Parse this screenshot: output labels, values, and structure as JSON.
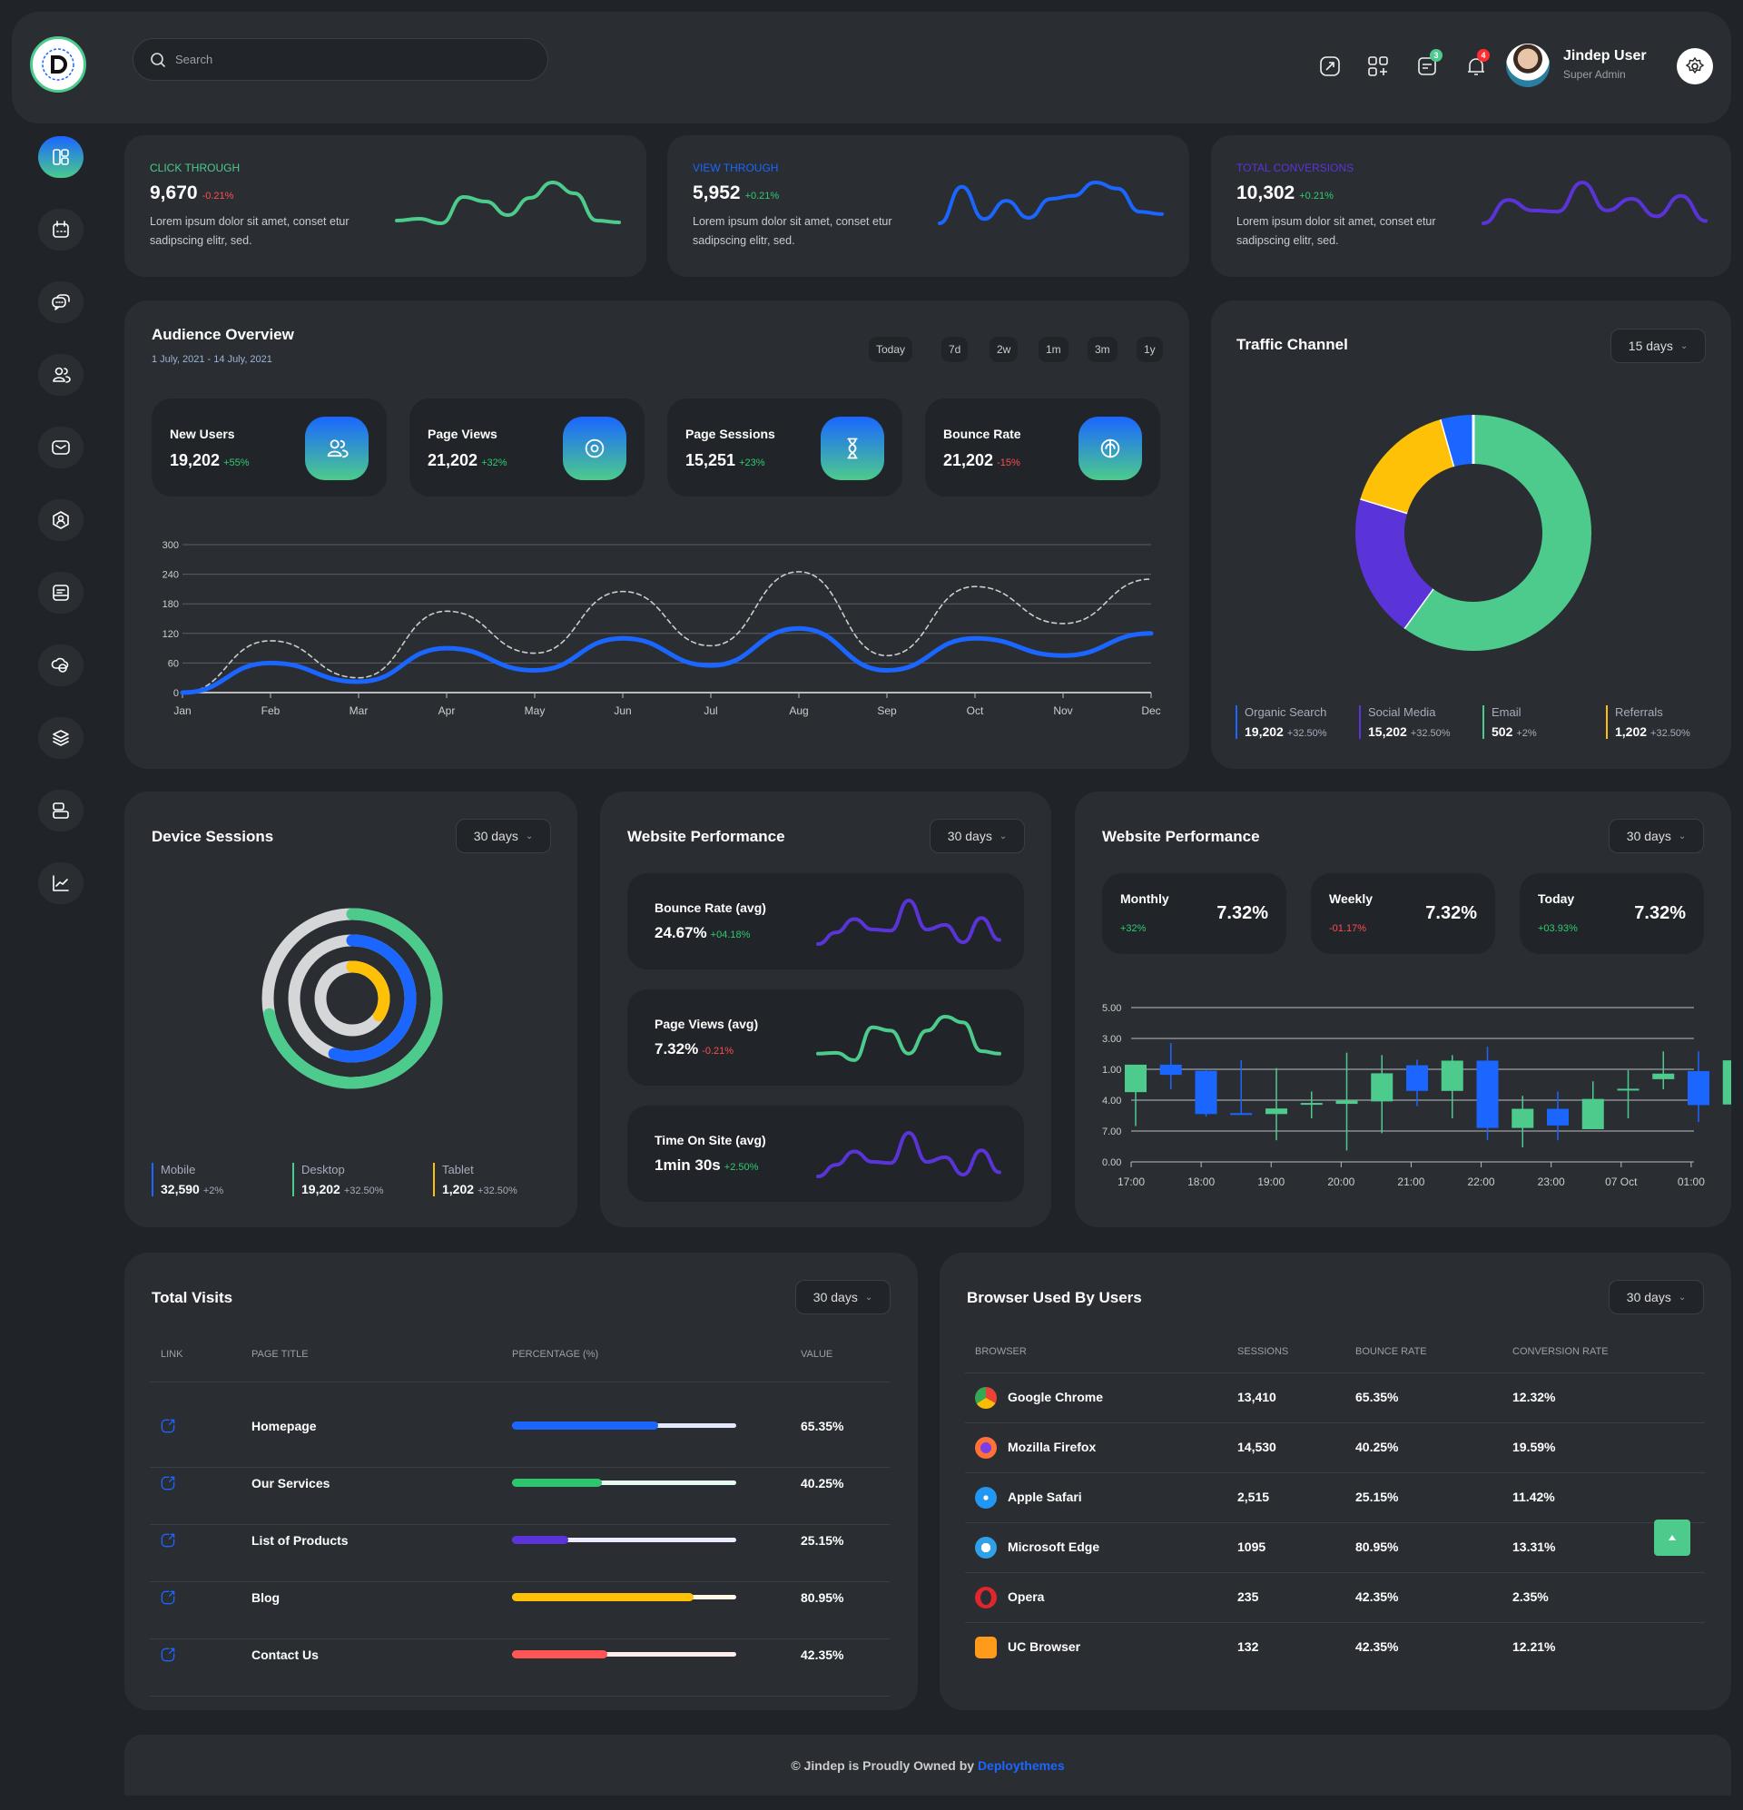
{
  "header": {
    "search_placeholder": "Search",
    "user_name": "Jindep User",
    "user_role": "Super Admin",
    "messages_badge": "3",
    "notifications_badge": "4",
    "logo_text": "DEPLOY THEMES"
  },
  "sidebar": {
    "items": [
      {
        "icon": "dashboard-icon",
        "active": true
      },
      {
        "icon": "calendar-icon"
      },
      {
        "icon": "chat-icon"
      },
      {
        "icon": "users-icon"
      },
      {
        "icon": "mail-icon"
      },
      {
        "icon": "profile-icon"
      },
      {
        "icon": "notes-icon"
      },
      {
        "icon": "cloud-icon"
      },
      {
        "icon": "layers-icon"
      },
      {
        "icon": "server-icon"
      },
      {
        "icon": "analytics-icon"
      }
    ]
  },
  "top_cards": [
    {
      "label": "CLICK THROUGH",
      "value": "9,670",
      "change": "-0.21%",
      "trend": "down",
      "desc1": "Lorem ipsum dolor sit amet, conset etur",
      "desc2": "sadipscing elitr, sed.",
      "color": "#4ccb8c",
      "spark": [
        30,
        32,
        27,
        56,
        51,
        36,
        55,
        72,
        60,
        30,
        28
      ]
    },
    {
      "label": "VIEW THROUGH",
      "value": "5,952",
      "change": "+0.21%",
      "trend": "up",
      "desc1": "Lorem ipsum dolor sit amet, conset etur",
      "desc2": "sadipscing elitr, sed.",
      "color": "#1a66ff",
      "spark": [
        5,
        65,
        12,
        42,
        14,
        45,
        50,
        72,
        62,
        24,
        20
      ]
    },
    {
      "label": "TOTAL CONVERSIONS",
      "value": "10,302",
      "change": "+0.21%",
      "trend": "up",
      "desc1": "Lorem ipsum dolor sit amet, conset etur",
      "desc2": "sadipscing elitr, sed.",
      "color": "#5b34d9",
      "spark": [
        8,
        48,
        30,
        28,
        78,
        30,
        50,
        20,
        55,
        12
      ]
    }
  ],
  "audience": {
    "title": "Audience Overview",
    "date_range": "1 July, 2021 - 14 July, 2021",
    "ranges": [
      "Today",
      "7d",
      "2w",
      "1m",
      "3m",
      "1y"
    ],
    "stats": [
      {
        "label": "New Users",
        "value": "19,202",
        "change": "+55%",
        "trend": "up",
        "icon": "users-icon"
      },
      {
        "label": "Page Views",
        "value": "21,202",
        "change": "+32%",
        "trend": "up",
        "icon": "eye-icon"
      },
      {
        "label": "Page Sessions",
        "value": "15,251",
        "change": "+23%",
        "trend": "up",
        "icon": "hourglass-icon"
      },
      {
        "label": "Bounce Rate",
        "value": "21,202",
        "change": "-15%",
        "trend": "down",
        "icon": "bounce-icon"
      }
    ]
  },
  "traffic": {
    "title": "Traffic Channel",
    "range": "15 days",
    "legend": [
      {
        "name": "Organic Search",
        "value": "19,202",
        "change": "+32.50%",
        "color": "#1a66ff"
      },
      {
        "name": "Social Media",
        "value": "15,202",
        "change": "+32.50%",
        "color": "#5b34d9"
      },
      {
        "name": "Email",
        "value": "502",
        "change": "+2%",
        "color": "#4ccb8c"
      },
      {
        "name": "Referrals",
        "value": "1,202",
        "change": "+32.50%",
        "color": "#ffc107"
      }
    ]
  },
  "device": {
    "title": "Device Sessions",
    "range": "30 days",
    "legend": [
      {
        "name": "Mobile",
        "value": "32,590",
        "change": "+2%",
        "color": "#1a66ff"
      },
      {
        "name": "Desktop",
        "value": "19,202",
        "change": "+32.50%",
        "color": "#4ccb8c"
      },
      {
        "name": "Tablet",
        "value": "1,202",
        "change": "+32.50%",
        "color": "#ffc107"
      }
    ]
  },
  "perf": {
    "title": "Website Performance",
    "range": "30 days",
    "items": [
      {
        "label": "Bounce Rate (avg)",
        "value": "24.67%",
        "change": "+04.18%",
        "trend": "up",
        "color": "#5b34d9",
        "spark": [
          5,
          25,
          48,
          30,
          28,
          80,
          30,
          38,
          8,
          50,
          12
        ]
      },
      {
        "label": "Page Views (avg)",
        "value": "7.32%",
        "change": "-0.21%",
        "trend": "down",
        "color": "#4ccb8c",
        "spark": [
          30,
          31,
          22,
          62,
          58,
          30,
          58,
          75,
          68,
          33,
          30
        ]
      },
      {
        "label": "Time On Site (avg)",
        "value": "1min 30s",
        "change": "+2.50%",
        "trend": "up",
        "color": "#5b34d9",
        "spark": [
          5,
          25,
          48,
          30,
          28,
          80,
          30,
          38,
          8,
          50,
          12
        ]
      }
    ]
  },
  "perf2": {
    "title": "Website Performance",
    "range": "30 days",
    "cards": [
      {
        "label": "Monthly",
        "change": "+32%",
        "trend": "up",
        "value": "7.32%"
      },
      {
        "label": "Weekly",
        "change": "-01.17%",
        "trend": "down",
        "value": "7.32%"
      },
      {
        "label": "Today",
        "change": "+03.93%",
        "trend": "up",
        "value": "7.32%"
      }
    ]
  },
  "total_visits": {
    "title": "Total Visits",
    "range": "30 days",
    "columns": [
      "LINK",
      "PAGE TITLE",
      "PERCENTAGE (%)",
      "VALUE"
    ],
    "rows": [
      {
        "title": "Homepage",
        "percent": 65.35,
        "value": "65.35%",
        "color": "#1a66ff",
        "track": "#e3e8ff"
      },
      {
        "title": "Our Services",
        "percent": 40.25,
        "value": "40.25%",
        "color": "#2dc56e",
        "track": "#e6fbf0"
      },
      {
        "title": "List of Products",
        "percent": 25.15,
        "value": "25.15%",
        "color": "#5b34d9",
        "track": "#eeeaff"
      },
      {
        "title": "Blog",
        "percent": 80.95,
        "value": "80.95%",
        "color": "#ffc107",
        "track": "#fff8e6"
      },
      {
        "title": "Contact Us",
        "percent": 42.35,
        "value": "42.35%",
        "color": "#ff5555",
        "track": "#ffeded"
      }
    ]
  },
  "browsers": {
    "title": "Browser Used By Users",
    "range": "30 days",
    "columns": [
      "BROWSER",
      "SESSIONS",
      "BOUNCE RATE",
      "CONVERSION RATE"
    ],
    "rows": [
      {
        "name": "Google Chrome",
        "icon": "chrome-icon",
        "sessions": "13,410",
        "bounce": "65.35%",
        "conversion": "12.32%"
      },
      {
        "name": "Mozilla Firefox",
        "icon": "firefox-icon",
        "sessions": "14,530",
        "bounce": "40.25%",
        "conversion": "19.59%"
      },
      {
        "name": "Apple Safari",
        "icon": "safari-icon",
        "sessions": "2,515",
        "bounce": "25.15%",
        "conversion": "11.42%"
      },
      {
        "name": "Microsoft Edge",
        "icon": "edge-icon",
        "sessions": "1095",
        "bounce": "80.95%",
        "conversion": "13.31%"
      },
      {
        "name": "Opera",
        "icon": "opera-icon",
        "sessions": "235",
        "bounce": "42.35%",
        "conversion": "2.35%"
      },
      {
        "name": "UC Browser",
        "icon": "uc-browser-icon",
        "sessions": "132",
        "bounce": "42.35%",
        "conversion": "12.21%"
      }
    ]
  },
  "footer": {
    "text": "© Jindep is Proudly Owned by ",
    "link": "Deploythemes"
  },
  "colors": {
    "green": "#4ccb8c",
    "blue": "#1a66ff",
    "purple": "#5b34d9",
    "yellow": "#ffc107",
    "red": "#ff4d4d"
  },
  "chart_data": [
    {
      "type": "line",
      "categories": [
        "Jan",
        "Feb",
        "Mar",
        "Apr",
        "May",
        "Jun",
        "Jul",
        "Aug",
        "Sep",
        "Oct",
        "Nov",
        "Dec"
      ],
      "yticks": [
        "0",
        "60",
        "120",
        "180",
        "240",
        "300"
      ],
      "ylim": [
        0,
        300
      ],
      "grid": true,
      "series": [
        {
          "style": "solid",
          "color": "#1a66ff",
          "values": [
            0,
            60,
            22,
            90,
            45,
            110,
            55,
            130,
            45,
            110,
            75,
            120
          ]
        },
        {
          "style": "dashed",
          "color": "#cccccc",
          "values": [
            0,
            105,
            30,
            165,
            80,
            205,
            95,
            245,
            75,
            215,
            140,
            230
          ]
        }
      ]
    },
    {
      "type": "pie",
      "variant": "donut",
      "slices": [
        {
          "color": "#4ccb8c",
          "fraction": 0.6
        },
        {
          "color": "#5b34d9",
          "fraction": 0.197
        },
        {
          "color": "#ffc107",
          "fraction": 0.159
        },
        {
          "color": "#1a66ff",
          "fraction": 0.044
        }
      ]
    },
    {
      "type": "radial-bar",
      "rings": [
        {
          "color": "#4ccb8c",
          "fraction": 0.72
        },
        {
          "color": "#1a66ff",
          "fraction": 0.55
        },
        {
          "color": "#ffc107",
          "fraction": 0.34
        }
      ]
    },
    {
      "type": "candlestick",
      "ytick_labels": [
        "5.00",
        "3.00",
        "1.00",
        "4.00",
        "7.00",
        "0.00"
      ],
      "ylim": [
        0,
        5
      ],
      "xtick_labels": [
        "17:00",
        "18:00",
        "19:00",
        "20:00",
        "21:00",
        "22:00",
        "23:00",
        "07 Oct",
        "01:00"
      ],
      "candles": [
        {
          "t": "17:00",
          "o": 2.26,
          "h": 3.15,
          "l": 1.16,
          "c": 3.15
        },
        {
          "t": "17:30",
          "o": 3.15,
          "h": 3.85,
          "l": 2.35,
          "c": 2.82
        },
        {
          "t": "18:00",
          "o": 2.95,
          "h": 2.99,
          "l": 1.47,
          "c": 1.55
        },
        {
          "t": "18:30",
          "o": 1.58,
          "h": 3.29,
          "l": 1.56,
          "c": 1.56
        },
        {
          "t": "19:00",
          "o": 1.55,
          "h": 3.04,
          "l": 0.7,
          "c": 1.73
        },
        {
          "t": "19:30",
          "o": 1.85,
          "h": 2.28,
          "l": 1.41,
          "c": 1.91
        },
        {
          "t": "20:00",
          "o": 1.88,
          "h": 3.54,
          "l": 0.37,
          "c": 1.99
        },
        {
          "t": "20:30",
          "o": 1.96,
          "h": 3.46,
          "l": 0.93,
          "c": 2.87
        },
        {
          "t": "21:00",
          "o": 3.13,
          "h": 3.31,
          "l": 1.81,
          "c": 2.3
        },
        {
          "t": "21:30",
          "o": 2.3,
          "h": 3.46,
          "l": 1.41,
          "c": 3.28
        },
        {
          "t": "22:00",
          "o": 3.28,
          "h": 3.73,
          "l": 0.7,
          "c": 1.1
        },
        {
          "t": "22:30",
          "o": 1.1,
          "h": 2.14,
          "l": 0.47,
          "c": 1.72
        },
        {
          "t": "23:00",
          "o": 1.72,
          "h": 2.28,
          "l": 0.7,
          "c": 1.18
        },
        {
          "t": "23:30",
          "o": 1.06,
          "h": 2.61,
          "l": 1.06,
          "c": 2.04
        },
        {
          "t": "00:00",
          "o": 2.33,
          "h": 2.97,
          "l": 1.41,
          "c": 2.37
        },
        {
          "t": "00:30",
          "o": 2.68,
          "h": 3.58,
          "l": 2.35,
          "c": 2.86
        },
        {
          "t": "01:00",
          "o": 2.94,
          "h": 3.58,
          "l": 1.29,
          "c": 1.84
        },
        {
          "t": "01:30",
          "o": 1.86,
          "h": 3.58,
          "l": 1.7,
          "c": 3.29
        }
      ]
    }
  ]
}
